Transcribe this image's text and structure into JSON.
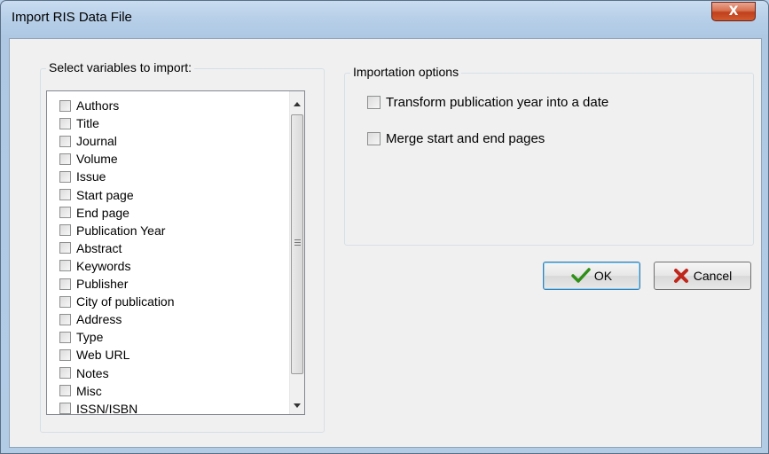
{
  "window": {
    "title": "Import RIS Data File",
    "close_glyph": "X"
  },
  "variables_group": {
    "label": "Select variables to import:",
    "items": [
      {
        "label": "Authors",
        "checked": false
      },
      {
        "label": "Title",
        "checked": false
      },
      {
        "label": "Journal",
        "checked": false
      },
      {
        "label": "Volume",
        "checked": false
      },
      {
        "label": "Issue",
        "checked": false
      },
      {
        "label": "Start page",
        "checked": false
      },
      {
        "label": "End page",
        "checked": false
      },
      {
        "label": "Publication Year",
        "checked": false
      },
      {
        "label": "Abstract",
        "checked": false
      },
      {
        "label": "Keywords",
        "checked": false
      },
      {
        "label": "Publisher",
        "checked": false
      },
      {
        "label": "City of publication",
        "checked": false
      },
      {
        "label": "Address",
        "checked": false
      },
      {
        "label": "Type",
        "checked": false
      },
      {
        "label": "Web URL",
        "checked": false
      },
      {
        "label": "Notes",
        "checked": false
      },
      {
        "label": "Misc",
        "checked": false
      },
      {
        "label": "ISSN/ISBN",
        "checked": false
      }
    ]
  },
  "importation_group": {
    "label": "Importation options",
    "options": [
      {
        "label": "Transform publication year into a date",
        "checked": false
      },
      {
        "label": "Merge start and end pages",
        "checked": false
      }
    ]
  },
  "buttons": {
    "ok_label": "OK",
    "cancel_label": "Cancel"
  },
  "colors": {
    "ok_icon": "#2f8f17",
    "cancel_icon": "#c0271c",
    "close_button": "#c0401d"
  },
  "icons": {
    "ok": "checkmark-icon",
    "cancel": "cross-icon",
    "close": "close-icon"
  }
}
